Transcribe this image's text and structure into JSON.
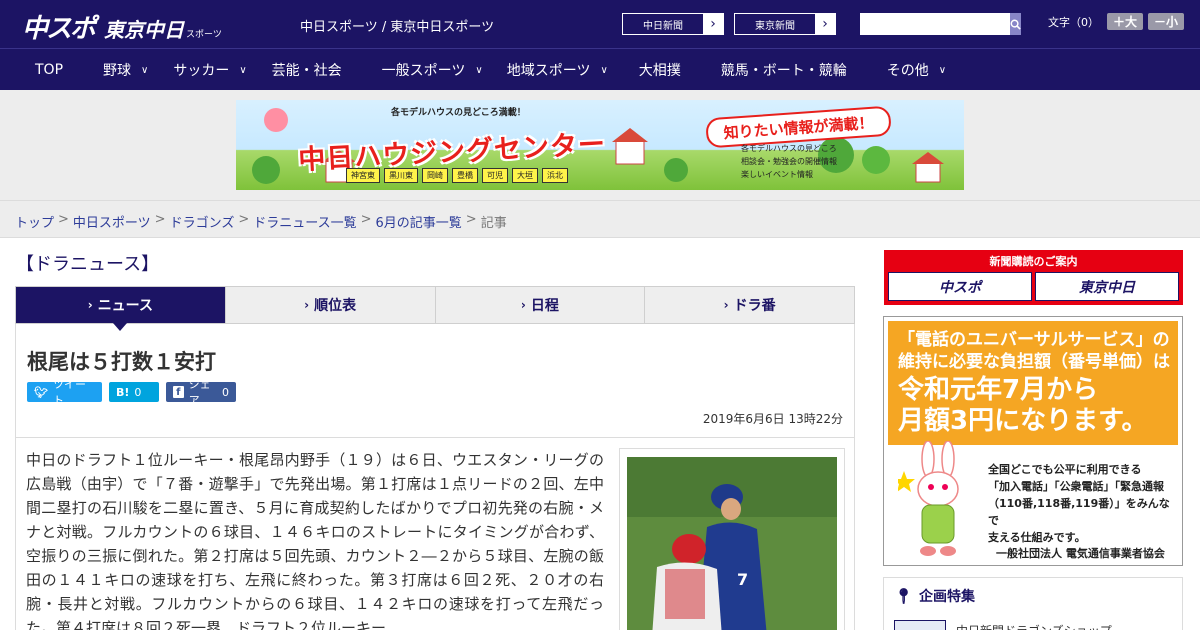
{
  "header": {
    "logo_primary": "中スポ",
    "logo_secondary": "東京中日",
    "logo_secondary_small": "スポーツ",
    "site_name": "中日スポーツ / 東京中日スポーツ",
    "site_links": [
      {
        "label": "中日新聞"
      },
      {
        "label": "東京新聞"
      }
    ],
    "search": {
      "placeholder": ""
    },
    "font_size": {
      "label": "文字（0）",
      "plus": "＋大",
      "minus": "－小"
    }
  },
  "nav": {
    "items": [
      {
        "label": "TOP",
        "has_dropdown": false
      },
      {
        "label": "野球",
        "has_dropdown": true
      },
      {
        "label": "サッカー",
        "has_dropdown": true
      },
      {
        "label": "芸能・社会",
        "has_dropdown": false
      },
      {
        "label": "一般スポーツ",
        "has_dropdown": true
      },
      {
        "label": "地域スポーツ",
        "has_dropdown": true
      },
      {
        "label": "大相撲",
        "has_dropdown": false
      },
      {
        "label": "競馬・ボート・競輪",
        "has_dropdown": false
      },
      {
        "label": "その他",
        "has_dropdown": true
      }
    ]
  },
  "banner": {
    "sub": "各モデルハウスの見どころ満載！",
    "title": "中日ハウジングセンター",
    "bubble": "知りたい情報が満載！",
    "features": [
      "各モデルハウスの見どころ",
      "相談会・勉強会の開催情報",
      "楽しいイベント情報"
    ],
    "cities": [
      "神宮東",
      "黒川東",
      "岡崎",
      "豊橋",
      "可児",
      "大垣",
      "浜北"
    ]
  },
  "breadcrumb": {
    "items": [
      "トップ",
      "中日スポーツ",
      "ドラゴンズ",
      "ドラニュース一覧",
      "6月の記事一覧"
    ],
    "current": "記事",
    "separator": ">"
  },
  "section": {
    "title": "【ドラニュース】"
  },
  "tabs": [
    {
      "label": "ニュース",
      "active": true
    },
    {
      "label": "順位表",
      "active": false
    },
    {
      "label": "日程",
      "active": false
    },
    {
      "label": "ドラ番",
      "active": false
    }
  ],
  "article": {
    "headline": "根尾は５打数１安打",
    "share": {
      "tweet": "ツイート",
      "hatena_icon": "B!",
      "hatena_count": "0",
      "facebook": "シェア",
      "facebook_count": "0"
    },
    "date": "2019年6月6日 13時22分",
    "body": "中日のドラフト１位ルーキー・根尾昂内野手（１９）は６日、ウエスタン・リーグの広島戦（由宇）で「７番・遊撃手」で先発出場。第１打席は１点リードの２回、左中間二塁打の石川駿を二塁に置き、５月に育成契約したばかりでプロ初先発の右腕・メナと対戦。フルカウントの６球目、１４６キロのストレートにタイミングが合わず、空振りの三振に倒れた。第２打席は５回先頭、カウント２―２から５球目、左腕の飯田の１４１キロの速球を打ち、左飛に終わった。第３打席は６回２死、２０才の右腕・長井と対戦。フルカウントからの６球目、１４２キロの速球を打って左飛だった。第４打席は８回２死一塁、ドラフト２位ルーキー"
  },
  "sidebar": {
    "subscribe": {
      "header": "新聞購読のご案内",
      "logo1": "中スポ",
      "logo2": "東京中日"
    },
    "ad": {
      "line1": "「電話のユニバーサルサービス」の",
      "line2": "維持に必要な負担額（番号単価）は",
      "line3": "令和元年7月から",
      "line4": "月額3円になります。",
      "body1": "全国どこでも公平に利用できる",
      "body2": "「加入電話」「公衆電話」「緊急通報",
      "body3": "（110番,118番,119番）」をみんなで",
      "body4": "支える仕組みです。",
      "org": "一般社団法人 電気通信事業者協会"
    },
    "special": {
      "header": "企画特集",
      "item": "中日新聞ドラゴンズショップ"
    }
  },
  "colors": {
    "brand_navy": "#1c1464",
    "accent_red": "#e60012",
    "tweet_blue": "#1da1f2",
    "facebook_blue": "#3b5998"
  }
}
